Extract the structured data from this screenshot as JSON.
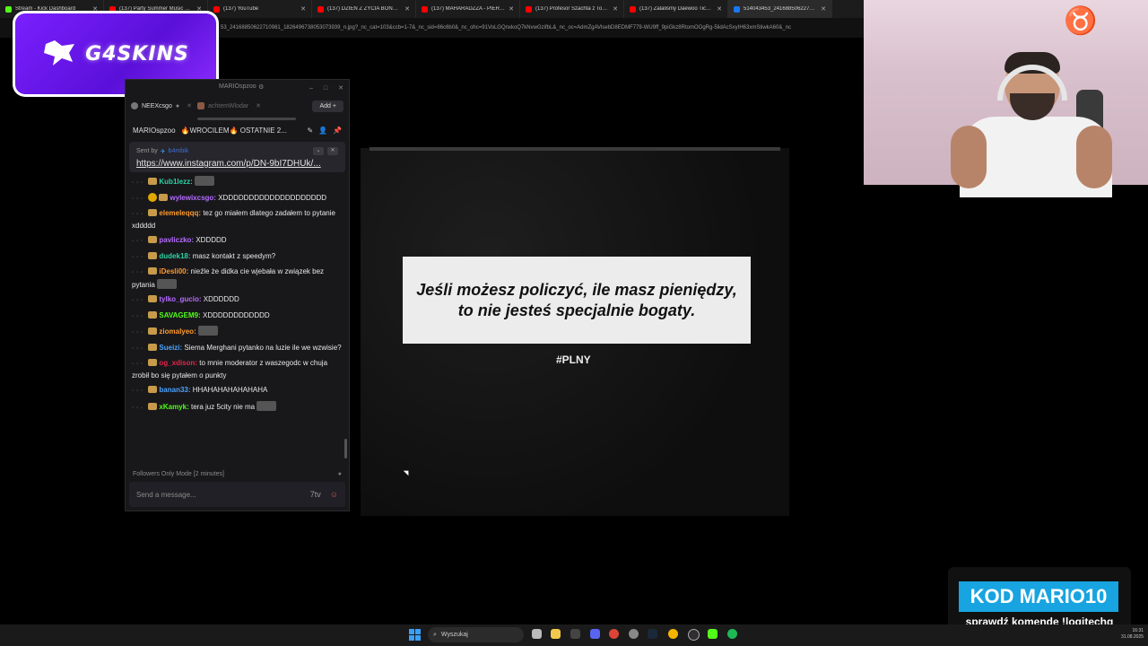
{
  "browser": {
    "tabs": [
      {
        "label": "Stream - Kick Dashboard",
        "fav": "#53fc18"
      },
      {
        "label": "(137) Party Summer Music M...",
        "fav": "#ff0000"
      },
      {
        "label": "(137) YouTube",
        "fav": "#ff0000"
      },
      {
        "label": "(137) DZIEŃ Z ŻYCIA BONUSA...",
        "fav": "#ff0000"
      },
      {
        "label": "(137) MAHARADZZA - PIERW...",
        "fav": "#ff0000"
      },
      {
        "label": "(137) Profesor Szachta z Toru...",
        "fav": "#ff0000"
      },
      {
        "label": "(137) Zalaliśmy Daewoo Tico...",
        "fav": "#ff0000"
      },
      {
        "label": "514043453_2416885062271098...",
        "fav": "#1877f2"
      }
    ],
    "url": "53_24168850622710981_1826496738053073939_n.jpg?_nc_cat=103&ccb=1-7&_nc_sid=86c6b0&_nc_ohc=91VoLGQnxkoQ7kNvwGzifbL&_nc_oc=AdmZgAVlsebD8EDMF779-WU9ff_9piGkz8RtomOOgRg-5lidAcSxyIH63xmStiwkA60&_nc"
  },
  "logo": {
    "text": "G4SKINS"
  },
  "chat": {
    "window_title": "MARIOspzoo",
    "tabs": [
      {
        "label": "NEEXcsgo"
      },
      {
        "label": "achtemWlodar"
      }
    ],
    "add_label": "Add",
    "channel": "MARIOspzoo",
    "stream_title": "🔥WROCILEM🔥 OSTATNIE 2...",
    "pinned": {
      "sent_by_label": "Sent by",
      "sent_by_user": "b4mbik",
      "link": "https://www.instagram.com/p/DN-9bI7DHUk/..."
    },
    "messages": [
      {
        "user": "Kub1lezz:",
        "color": "#2ed3a3",
        "text": "",
        "emote": true
      },
      {
        "user": "wylewixcsgo:",
        "color": "#b66bff",
        "text": "XDDDDDDDDDDDDDDDDDDDD",
        "badge": true
      },
      {
        "user": "elemeleqqq:",
        "color": "#ff9a2e",
        "text": "tez go miałem dlatego zadałem to pytanie xddddd"
      },
      {
        "user": "pavliczko:",
        "color": "#b66bff",
        "text": "XDDDDD"
      },
      {
        "user": "dudek18:",
        "color": "#2ed3a3",
        "text": "masz kontakt z speedym?"
      },
      {
        "user": "iDesli00:",
        "color": "#ff9a2e",
        "text": "nieźle że didka cie wjebała w związek bez pytania",
        "emote": true
      },
      {
        "user": "tylko_gucio:",
        "color": "#b66bff",
        "text": "XDDDDDD"
      },
      {
        "user": "SAVAGEM9:",
        "color": "#53fc18",
        "text": "XDDDDDDDDDDDD"
      },
      {
        "user": "ziomalyeo:",
        "color": "#ff9a2e",
        "text": "",
        "emote": true
      },
      {
        "user": "Sueizi:",
        "color": "#4aa3ff",
        "text": "Siema Merghani pytanko na luzie ile we wzwisie?"
      },
      {
        "user": "og_xdison:",
        "color": "#e0264a",
        "text": "to mnie moderator z waszegodc w chuja zrobił bo się pytałem o punkty"
      },
      {
        "user": "banan33:",
        "color": "#4aa3ff",
        "text": "HHAHAHAHAHAHAHA"
      },
      {
        "user": "xKamyk:",
        "color": "#53fc18",
        "text": "tera juz 5city nie ma",
        "emote": true
      }
    ],
    "follow_mode": "Followers Only Mode [2 minutes]",
    "send_placeholder": "Send a message..."
  },
  "main": {
    "quote_line1": "Jeśli możesz policzyć, ile masz pieniędzy,",
    "quote_line2": "to nie jesteś specjalnie bogaty.",
    "hashtag": "#PLNY"
  },
  "kod": {
    "code": "KOD MARIO10",
    "subtitle": "sprawdź komendę !logitechg"
  },
  "taskbar": {
    "search_label": "Wyszukaj",
    "time": "16:31",
    "date": "31.08.2025"
  }
}
